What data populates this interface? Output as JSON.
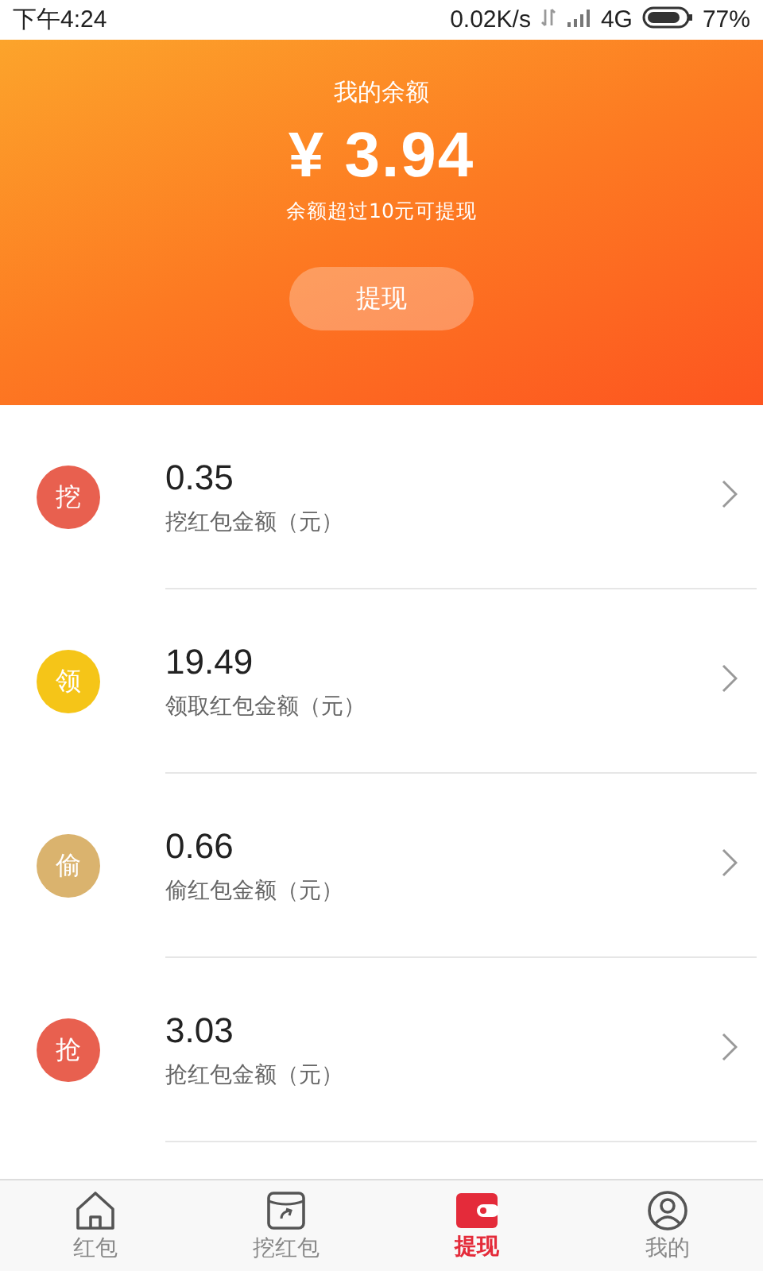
{
  "status_bar": {
    "time": "下午4:24",
    "speed": "0.02K/s",
    "network": "4G",
    "battery": "77%"
  },
  "balance": {
    "title": "我的余额",
    "amount": "¥ 3.94",
    "note": "余额超过10元可提现",
    "button": "提现"
  },
  "rows": [
    {
      "badge": "挖",
      "color": "#e8604f",
      "value": "0.35",
      "label": "挖红包金额（元）"
    },
    {
      "badge": "领",
      "color": "#f5c518",
      "value": "19.49",
      "label": "领取红包金额（元）"
    },
    {
      "badge": "偷",
      "color": "#dab36e",
      "value": "0.66",
      "label": "偷红包金额（元）"
    },
    {
      "badge": "抢",
      "color": "#e8604f",
      "value": "3.03",
      "label": "抢红包金额（元）"
    }
  ],
  "tabs": [
    {
      "kind": "home",
      "label": "红包",
      "selected": false
    },
    {
      "kind": "dig",
      "label": "挖红包",
      "selected": false
    },
    {
      "kind": "wallet",
      "label": "提现",
      "selected": true
    },
    {
      "kind": "profile",
      "label": "我的",
      "selected": false
    }
  ]
}
